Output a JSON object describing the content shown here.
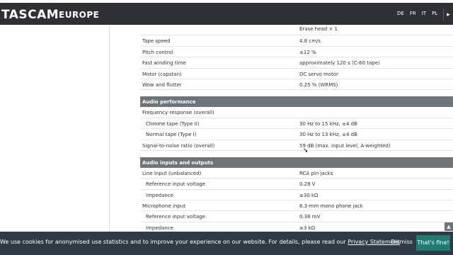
{
  "header": {
    "brand": "TASCAM",
    "region": "EUROPE",
    "languages": [
      "DE",
      "FR",
      "IT",
      "PL"
    ]
  },
  "specs": {
    "top_rows": [
      {
        "key": "",
        "value": "Erase head × 1",
        "indent": false
      },
      {
        "key": "Tape speed",
        "value": "4.8 cm/s",
        "indent": false
      },
      {
        "key": "Pitch control",
        "value": "±12 %",
        "indent": false
      },
      {
        "key": "Fast winding time",
        "value": "approximately 120 s (C-60 tape)",
        "indent": false
      },
      {
        "key": "Motor (capstan)",
        "value": "DC servo motor",
        "indent": false
      },
      {
        "key": "Wow and flutter",
        "value": "0.25 % (WRMS)",
        "indent": false
      }
    ],
    "audio_performance": {
      "title": "Audio performance",
      "rows": [
        {
          "key": "Frequency response (overall)",
          "value": "",
          "indent": false
        },
        {
          "key": "Chrome tape (Type II)",
          "value": "30 Hz to 15 kHz, ±4 dB",
          "indent": true
        },
        {
          "key": "Normal tape (Type I)",
          "value": "30 Hz to 13 kHz, ±4 dB",
          "indent": true
        },
        {
          "key": "Signal-to-noise ratio (overall)",
          "value": "59 dB (max. input level, A-weighted)",
          "indent": false
        }
      ]
    },
    "audio_io": {
      "title": "Audio inputs and outputs",
      "rows": [
        {
          "key": "Line input (unbalanced)",
          "value": "RCA pin jacks",
          "indent": false
        },
        {
          "key": "Reference input voltage",
          "value": "0.28 V",
          "indent": true
        },
        {
          "key": "Impedance",
          "value": "≥30 kΩ",
          "indent": true
        },
        {
          "key": "Microphone input",
          "value": "6.3-mm mono phone jack",
          "indent": false
        },
        {
          "key": "Reference input voltage",
          "value": "0.38 mV",
          "indent": true
        },
        {
          "key": "Impedance",
          "value": "≥3 kΩ",
          "indent": true
        }
      ]
    }
  },
  "cookie": {
    "text": "We use cookies for anonymised use statistics and to improve your experience on our website. For details, please read our ",
    "link": "Privacy Statement",
    "dismiss": "Dismiss",
    "accept": "That's fine!"
  },
  "icons": {
    "scroll_up": "chevron-up-icon",
    "cursor": "mouse-pointer-icon"
  }
}
